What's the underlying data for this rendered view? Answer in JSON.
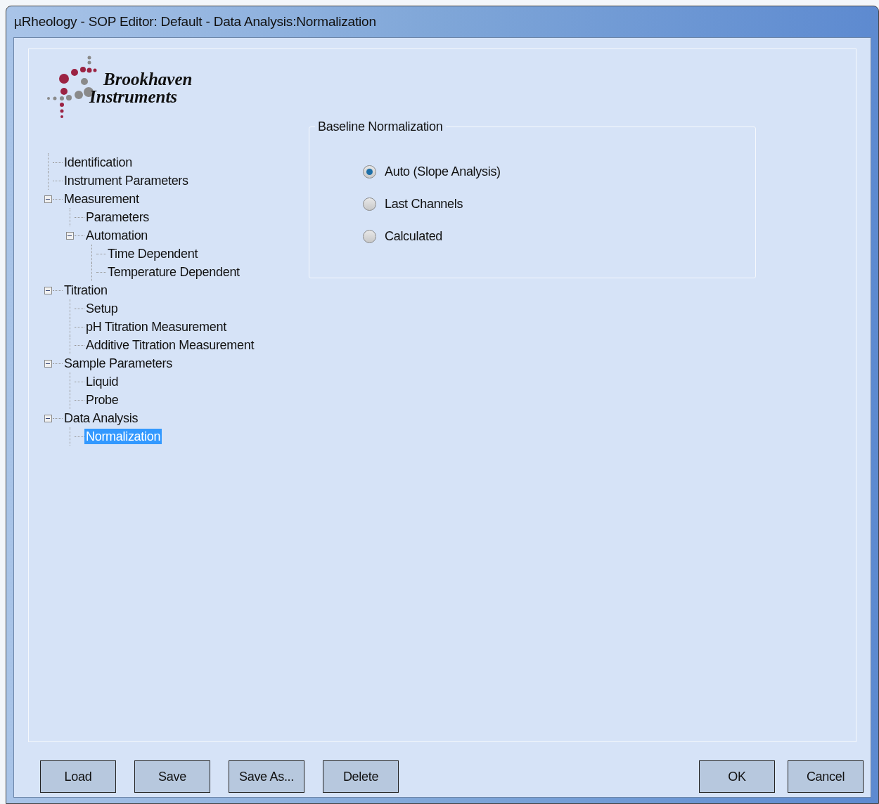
{
  "window": {
    "title": "µRheology - SOP Editor: Default - Data Analysis:Normalization"
  },
  "logo": {
    "line_1": "Brookhaven",
    "line_2": "Instruments"
  },
  "tree": [
    {
      "label": "Identification",
      "selected": false
    },
    {
      "label": "Instrument Parameters",
      "selected": false
    },
    {
      "label": "Measurement",
      "selected": false,
      "expanded": true,
      "children": [
        {
          "label": "Parameters",
          "selected": false
        },
        {
          "label": "Automation",
          "selected": false,
          "expanded": true,
          "children": [
            {
              "label": "Time Dependent",
              "selected": false
            },
            {
              "label": "Temperature Dependent",
              "selected": false
            }
          ]
        }
      ]
    },
    {
      "label": "Titration",
      "selected": false,
      "expanded": true,
      "children": [
        {
          "label": "Setup",
          "selected": false
        },
        {
          "label": "pH Titration Measurement",
          "selected": false
        },
        {
          "label": "Additive Titration Measurement",
          "selected": false
        }
      ]
    },
    {
      "label": "Sample Parameters",
      "selected": false,
      "expanded": true,
      "children": [
        {
          "label": "Liquid",
          "selected": false
        },
        {
          "label": "Probe",
          "selected": false
        }
      ]
    },
    {
      "label": "Data Analysis",
      "selected": false,
      "expanded": true,
      "children": [
        {
          "label": "Normalization",
          "selected": true
        }
      ]
    }
  ],
  "group": {
    "title": "Baseline Normalization",
    "options": [
      {
        "label": "Auto (Slope Analysis)",
        "selected": true
      },
      {
        "label": "Last Channels",
        "selected": false
      },
      {
        "label": "Calculated",
        "selected": false
      }
    ]
  },
  "left_buttons": [
    "Load",
    "Save",
    "Save As...",
    "Delete"
  ],
  "right_buttons": [
    "OK",
    "Cancel"
  ]
}
